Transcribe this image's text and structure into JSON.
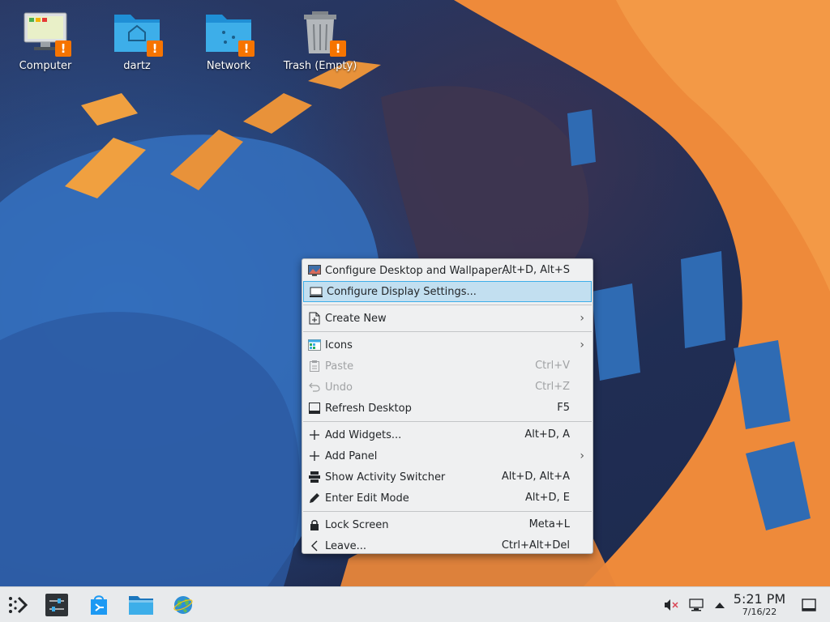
{
  "desktop": {
    "icons": [
      {
        "label": "Computer",
        "icon": "computer-icon"
      },
      {
        "label": "dartz",
        "icon": "home-folder-icon"
      },
      {
        "label": "Network",
        "icon": "network-folder-icon"
      },
      {
        "label": "Trash (Empty)",
        "icon": "trash-icon"
      }
    ],
    "warning_badge": "!"
  },
  "context_menu": {
    "items": [
      {
        "label": "Configure Desktop and Wallpaper...",
        "shortcut": "Alt+D, Alt+S",
        "icon": "desktop-wallpaper-icon"
      },
      {
        "label": "Configure Display Settings...",
        "shortcut": "",
        "icon": "monitor-icon",
        "highlighted": true
      },
      {
        "label": "Create New",
        "shortcut": "",
        "icon": "create-new-icon",
        "submenu": true
      },
      {
        "label": "Icons",
        "shortcut": "",
        "icon": "icons-view-icon",
        "submenu": true
      },
      {
        "label": "Paste",
        "shortcut": "Ctrl+V",
        "icon": "paste-icon",
        "disabled": true
      },
      {
        "label": "Undo",
        "shortcut": "Ctrl+Z",
        "icon": "undo-icon",
        "disabled": true
      },
      {
        "label": "Refresh Desktop",
        "shortcut": "F5",
        "icon": "refresh-desktop-icon"
      },
      {
        "label": "Add Widgets...",
        "shortcut": "Alt+D, A",
        "icon": "plus-icon"
      },
      {
        "label": "Add Panel",
        "shortcut": "",
        "icon": "plus-icon",
        "submenu": true
      },
      {
        "label": "Show Activity Switcher",
        "shortcut": "Alt+D, Alt+A",
        "icon": "activities-icon"
      },
      {
        "label": "Enter Edit Mode",
        "shortcut": "Alt+D, E",
        "icon": "pencil-icon"
      },
      {
        "label": "Lock Screen",
        "shortcut": "Meta+L",
        "icon": "lock-icon"
      },
      {
        "label": "Leave...",
        "shortcut": "Ctrl+Alt+Del",
        "icon": "chevron-left-icon"
      }
    ],
    "highlight_color": "#c2dff0",
    "highlight_border": "#3daee9"
  },
  "taskbar": {
    "launchers": [
      {
        "name": "application-launcher",
        "icon": "kde-launcher-icon"
      },
      {
        "name": "system-settings",
        "icon": "settings-icon"
      },
      {
        "name": "discover",
        "icon": "discover-icon"
      },
      {
        "name": "file-manager",
        "icon": "dolphin-icon"
      },
      {
        "name": "web-browser",
        "icon": "browser-icon"
      }
    ],
    "tray": [
      {
        "name": "volume-muted",
        "icon": "volume-muted-icon"
      },
      {
        "name": "network",
        "icon": "network-icon"
      },
      {
        "name": "expand-tray",
        "icon": "chevron-up-icon"
      }
    ],
    "clock": {
      "time": "5:21 PM",
      "date": "7/16/22"
    },
    "show_desktop_icon": "show-desktop-icon"
  },
  "colors": {
    "accent": "#3daee9",
    "warning": "#f67400",
    "orange": "#f08a3c",
    "blue": "#2f6bb3"
  }
}
